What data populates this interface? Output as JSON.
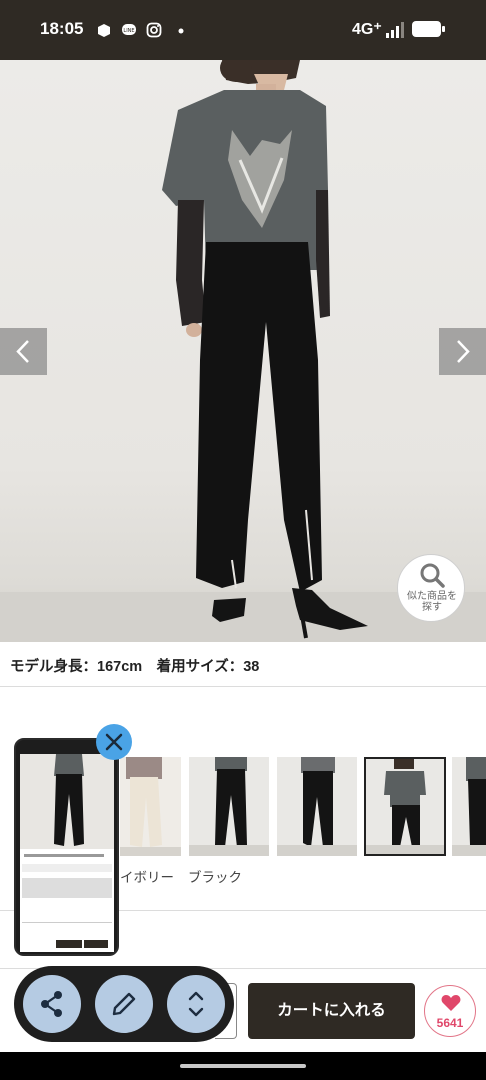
{
  "status_bar": {
    "time": "18:05",
    "network": "4G⁺",
    "icons": [
      "mail-app-icon",
      "line-app-icon",
      "instagram-icon",
      "dot-icon",
      "signal-icon",
      "battery-icon"
    ]
  },
  "hero": {
    "prev_icon": "chevron-left-icon",
    "next_icon": "chevron-right-icon",
    "similar_label_line1": "似た商品を",
    "similar_label_line2": "探す"
  },
  "model_info": "モデル身長：167cm　着用サイズ：38",
  "colors": {
    "ivory_label": "イボリー",
    "black_label": "ブラック"
  },
  "mini_preview": {
    "icon": "close-icon"
  },
  "actions": {
    "cart_label": "カートに入れる",
    "like_count": "5641",
    "share_icon": "share-icon",
    "edit_icon": "pencil-icon",
    "expand_icon": "expand-icon"
  },
  "theme": {
    "brand_dark": "#2f2a24",
    "like_pink": "#e0476a",
    "fab_blue": "#b5cbe3",
    "close_blue": "#4aa3e6"
  }
}
